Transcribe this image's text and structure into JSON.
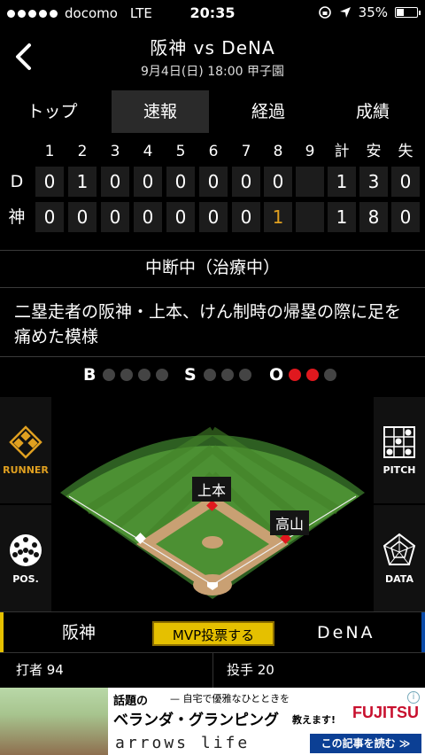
{
  "status_bar": {
    "carrier": "docomo",
    "network": "LTE",
    "time": "20:35",
    "battery_percent": "35%",
    "battery_level": 0.35
  },
  "header": {
    "title": "阪神 vs DeNA",
    "subtitle": "9月4日(日) 18:00 甲子園"
  },
  "tabs": [
    {
      "label": "トップ"
    },
    {
      "label": "速報",
      "active": true
    },
    {
      "label": "経過"
    },
    {
      "label": "成績"
    }
  ],
  "scoreboard": {
    "columns": [
      "1",
      "2",
      "3",
      "4",
      "5",
      "6",
      "7",
      "8",
      "9",
      "計",
      "安",
      "失"
    ],
    "rows": [
      {
        "team": "D",
        "innings": [
          "0",
          "1",
          "0",
          "0",
          "0",
          "0",
          "0",
          "0",
          ""
        ],
        "totals": [
          "1",
          "3",
          "0"
        ]
      },
      {
        "team": "神",
        "innings": [
          "0",
          "0",
          "0",
          "0",
          "0",
          "0",
          "0",
          "1",
          ""
        ],
        "totals": [
          "1",
          "8",
          "0"
        ]
      }
    ]
  },
  "game_status": "中断中（治療中）",
  "play_description": "二塁走者の阪神・上本、けん制時の帰塁の際に足を痛めた模様",
  "count": {
    "ball_label": "B",
    "balls": 0,
    "ball_max": 4,
    "strike_label": "S",
    "strikes": 0,
    "strike_max": 3,
    "out_label": "O",
    "outs": 2,
    "out_max": 3
  },
  "field": {
    "runner_button": "RUNNER",
    "pos_button": "POS.",
    "pitch_button": "PITCH",
    "data_button": "DATA",
    "players": {
      "second_base": "上本",
      "first_area": "高山"
    }
  },
  "team_bar": {
    "home_team": "阪神",
    "mvp_label": "MVP投票する",
    "away_team": "DeNA"
  },
  "player_row": {
    "batter": "打者 94",
    "pitcher": "投手 20"
  },
  "ad": {
    "headline": "話題の",
    "sub": "— 自宅で優雅なひとときを",
    "main": "ベランダ・グランピング",
    "teach": "教えます!",
    "brand": "FUJITSU",
    "product": "arrows life",
    "cta": "この記事を読む ≫"
  },
  "colors": {
    "accent_yellow": "#e5c000",
    "out_red": "#e0181e",
    "field_green": "#3f8a2e",
    "dirt": "#c9a073"
  }
}
